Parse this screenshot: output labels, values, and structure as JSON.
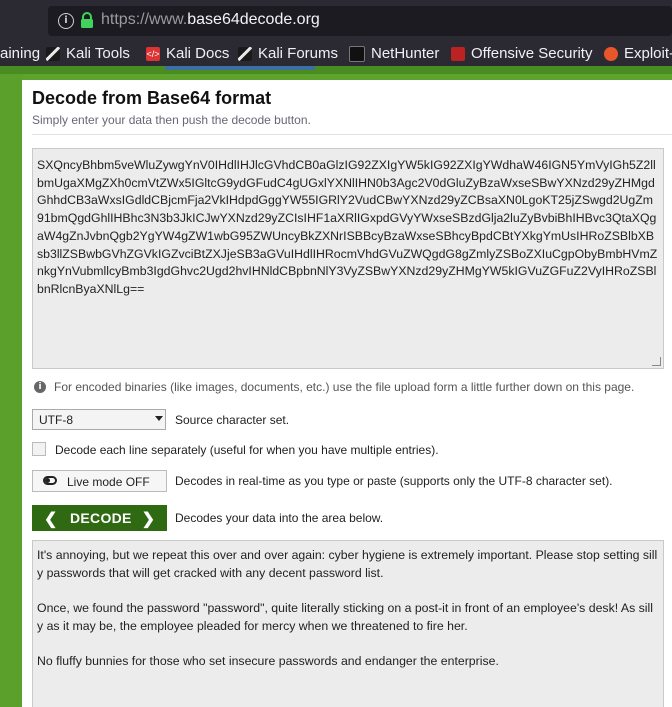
{
  "browser": {
    "url_prefix": "https://www.",
    "url_host": "base64decode.org"
  },
  "bookmarks": [
    {
      "label": "aining",
      "icon": "none"
    },
    {
      "label": "Kali Tools",
      "icon": "kali-icon"
    },
    {
      "label": "Kali Docs",
      "icon": "kali-docs-icon"
    },
    {
      "label": "Kali Forums",
      "icon": "kali-icon"
    },
    {
      "label": "NetHunter",
      "icon": "nethunter-icon"
    },
    {
      "label": "Offensive Security",
      "icon": "offsec-icon"
    },
    {
      "label": "Exploit-",
      "icon": "exploit-db-icon"
    }
  ],
  "page": {
    "title": "Decode from Base64 format",
    "subtitle": "Simply enter your data then push the decode button.",
    "input_text": "SXQncyBhbm5veWluZywgYnV0IHdlIHJlcGVhdCB0aGlzIG92ZXIgYW5kIG92ZXIgYWdhaW46IGN5YmVyIGh5Z2llbmUgaXMgZXh0cmVtZWx5IGltcG9ydGFudC4gUGxlYXNlIHN0b3Agc2V0dGluZyBzaWxseSBwYXNzd29yZHMgdGhhdCB3aWxsIGdldCBjcmFja2VkIHdpdGggYW55IGRlY2VudCBwYXNzd29yZCBsaXN0LgoKT25jZSwgd2UgZm91bmQgdGhlIHBhc3N3b3JkICJwYXNzd29yZCIsIHF1aXRlIGxpdGVyYWxseSBzdGlja2luZyBvbiBhIHBvc3QtaXQgaW4gZnJvbnQgb2YgYW4gZW1wbG95ZWUncyBkZXNrISBBcyBzaWxseSBhcyBpdCBtYXkgYmUsIHRoZSBlbXBsb3llZSBwbGVhZGVkIGZvciBtZXJjeSB3aGVuIHdlIHRocmVhdGVuZWQgdG8gZmlyZSBoZXIuCgpObyBmbHVmZnkgYnVubmllcyBmb3IgdGhvc2Ugd2hvIHNldCBpbnNlY3VyZSBwYXNzd29yZHMgYW5kIGVuZGFuZ2VyIHRoZSBlbnRlcnByaXNlLg==",
    "binary_note": "For encoded binaries (like images, documents, etc.) use the file upload form a little further down on this page.",
    "charset_value": "UTF-8",
    "charset_label": "Source character set.",
    "each_line_label": "Decode each line separately (useful for when you have multiple entries).",
    "live_mode_label": "Live mode OFF",
    "live_mode_desc": "Decodes in real-time as you type or paste (supports only the UTF-8 character set).",
    "decode_label": "DECODE",
    "decode_desc": "Decodes your data into the area below.",
    "output_paragraphs": [
      "It's annoying, but we repeat this over and over again: cyber hygiene is extremely important. Please stop setting silly passwords that will get cracked with any decent password list.",
      "Once, we found the password \"password\", quite literally sticking on a post-it in front of an employee's desk! As silly as it may be, the employee pleaded for mercy when we threatened to fire her.",
      "No fluffy bunnies for those who set insecure passwords and endanger the enterprise."
    ]
  }
}
